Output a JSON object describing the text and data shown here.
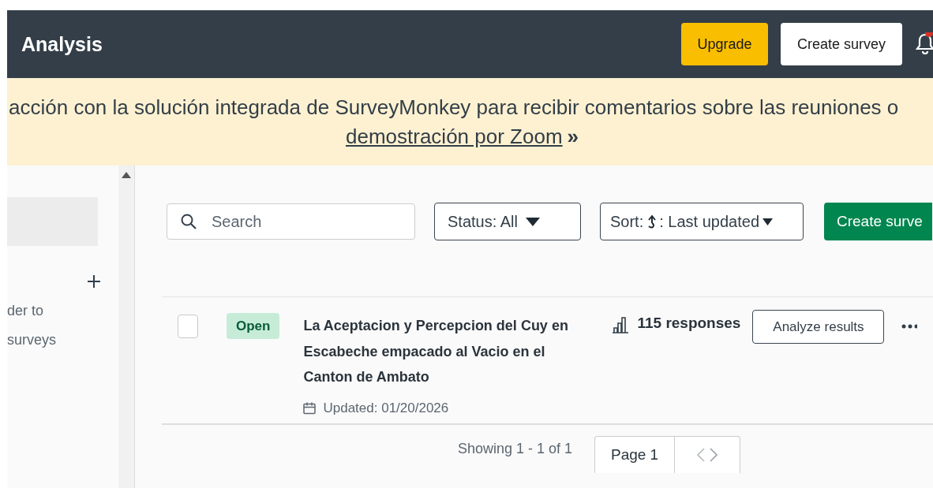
{
  "header": {
    "title": "Analysis",
    "buttons": [
      {
        "label": "Upgrade",
        "kind": "upgrade"
      },
      {
        "label": "Create survey",
        "kind": "secondary"
      }
    ],
    "notifications": {
      "unread": true
    }
  },
  "banner": {
    "text": "acción con la solución integrada de SurveyMonkey para recibir comentarios sobre las reuniones o",
    "link": "demostración por Zoom",
    "suffix": "»"
  },
  "sidebar": {
    "hint_lines": [
      "der to",
      "surveys"
    ]
  },
  "toolbar": {
    "search": {
      "placeholder": "Search"
    },
    "status_filter": "Status: All",
    "sort": {
      "prefix": "Sort:",
      "value": ": Last updated"
    },
    "create_button": "Create surve"
  },
  "surveys": [
    {
      "checked": false,
      "status": "Open",
      "title": "La Aceptacion y Percepcion del Cuy en Escabeche empacado al Vacio en el Canton de Ambato",
      "updated": "Updated: 01/20/2026",
      "responses": "115 responses",
      "action": "Analyze results"
    }
  ],
  "footer": {
    "showing": "Showing 1 - 1 of 1",
    "page": "Page 1"
  }
}
